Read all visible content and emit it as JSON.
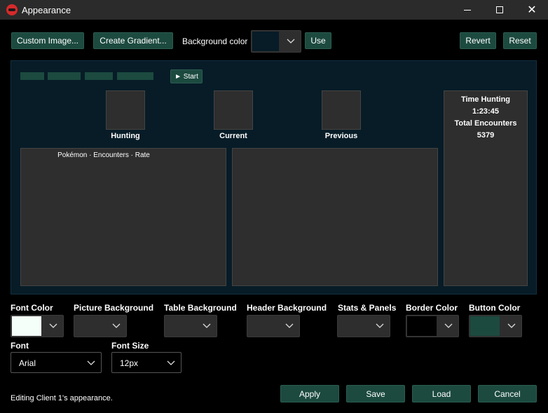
{
  "window": {
    "title": "Appearance"
  },
  "toolbar": {
    "custom_image_label": "Custom Image...",
    "create_gradient_label": "Create Gradient...",
    "background_color_label": "Background color",
    "use_label": "Use",
    "revert_label": "Revert",
    "reset_label": "Reset"
  },
  "preview": {
    "start_label": "► Start",
    "pictures": [
      {
        "label": "Hunting"
      },
      {
        "label": "Current"
      },
      {
        "label": "Previous"
      }
    ],
    "table_header": "Pokémon · Encounters · Rate",
    "stats": {
      "time_label": "Time Hunting",
      "time_value": "1:23:45",
      "encounters_label": "Total Encounters",
      "encounters_value": "5379"
    }
  },
  "settings": {
    "font_color_label": "Font Color",
    "picture_background_label": "Picture Background",
    "table_background_label": "Table Background",
    "header_background_label": "Header Background",
    "stats_panels_label": "Stats & Panels",
    "border_color_label": "Border Color",
    "button_color_label": "Button Color",
    "font_label": "Font",
    "font_value": "Arial",
    "font_size_label": "Font Size",
    "font_size_value": "12px"
  },
  "colors": {
    "background": "#071c27",
    "font": "#f4fff9",
    "picture_background": "#2e2e2e",
    "table_background": "#2e2e2e",
    "header_background": "#2e2e2e",
    "stats_panels": "#2e2e2e",
    "border": "#000000",
    "button": "#1c4a3f"
  },
  "actions": {
    "apply_label": "Apply",
    "save_label": "Save",
    "load_label": "Load",
    "cancel_label": "Cancel"
  },
  "status": {
    "text": "Editing Client 1's appearance."
  }
}
